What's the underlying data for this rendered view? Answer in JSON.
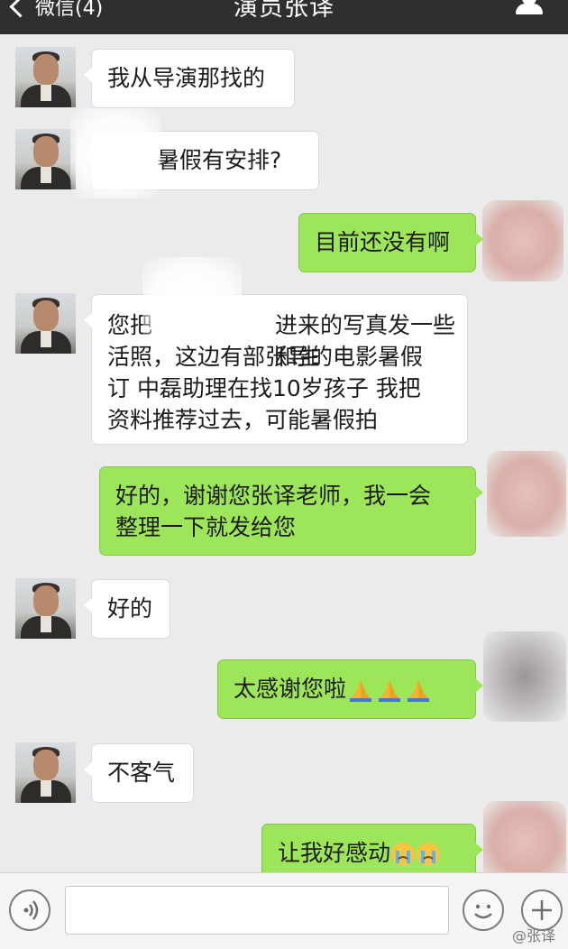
{
  "header": {
    "back_label": "微信(4)",
    "title": "演员张译"
  },
  "messages": [
    {
      "side": "left",
      "text": "我从导演那找的"
    },
    {
      "side": "left",
      "text": "暑假有安排?"
    },
    {
      "side": "right",
      "text": "目前还没有啊"
    },
    {
      "side": "left",
      "lines": [
        "您把",
        "进来的写真发一些和生",
        "活照，这边有部张导的电影暑假",
        "订 中磊助理在找10岁孩子 我把",
        "资料推荐过去，可能暑假拍"
      ]
    },
    {
      "side": "right",
      "lines": [
        "好的，谢谢您张译老师，我一会",
        "整理一下就发给您"
      ]
    },
    {
      "side": "left",
      "text": "好的"
    },
    {
      "side": "right",
      "text": "太感谢您啦",
      "emoji": "folded-hands x3"
    },
    {
      "side": "left",
      "text": "不客气"
    },
    {
      "side": "right",
      "text": "让我好感动",
      "emoji": "crying-face x2"
    }
  ],
  "input_bar": {
    "value": ""
  },
  "watermark": "@张译",
  "colors": {
    "header": "#2f2f32",
    "sent_bubble": "#9ee659",
    "received_bubble": "#ffffff",
    "background": "#ebebeb"
  }
}
